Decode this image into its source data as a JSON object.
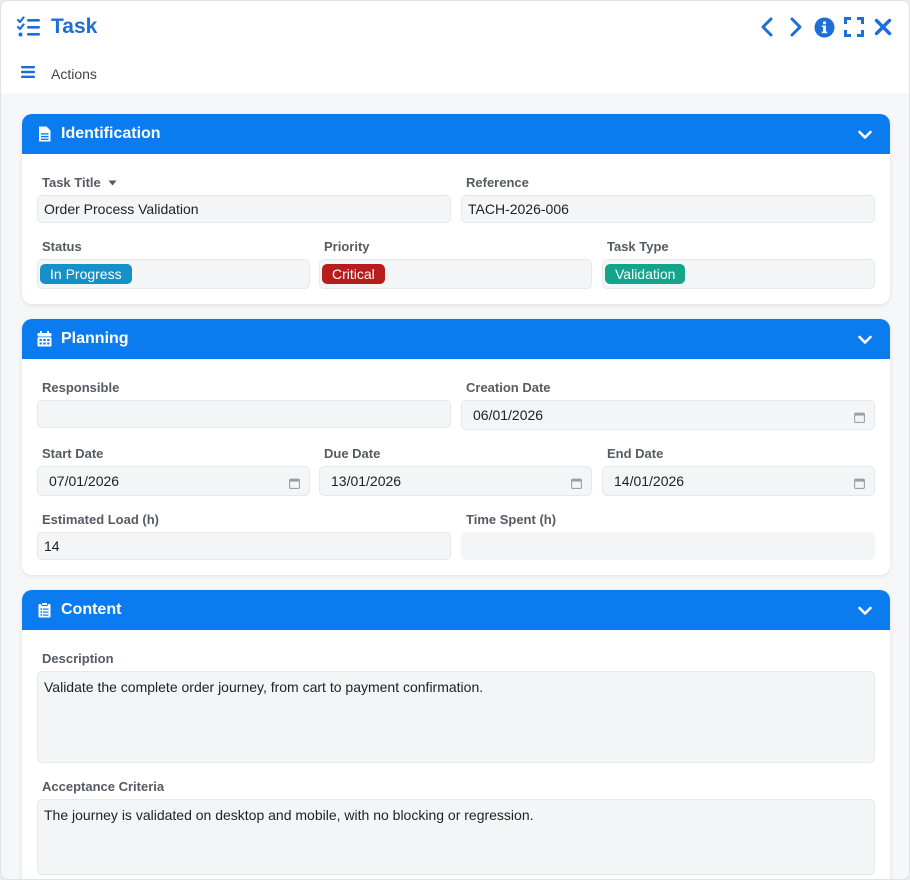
{
  "window": {
    "title": "Task",
    "actions_label": "Actions",
    "icons": [
      "tasks-list-icon",
      "chevron-left-icon",
      "chevron-right-icon",
      "info-icon",
      "fullscreen-icon",
      "close-icon",
      "hamburger-menu-icon"
    ]
  },
  "colors": {
    "accent": "#0b7bf0",
    "title": "#1d6fd8",
    "status_in_progress": "#1690c8",
    "priority_critical": "#b81d1d",
    "type_validation": "#12a58c"
  },
  "identification": {
    "section_title": "Identification",
    "task_title_label": "Task Title",
    "task_title_value": "Order Process Validation",
    "reference_label": "Reference",
    "reference_value": "TACH-2026-006",
    "status_label": "Status",
    "status_value": "In Progress",
    "priority_label": "Priority",
    "priority_value": "Critical",
    "task_type_label": "Task Type",
    "task_type_value": "Validation"
  },
  "planning": {
    "section_title": "Planning",
    "responsible_label": "Responsible",
    "responsible_value": "",
    "creation_date_label": "Creation Date",
    "creation_date_value": "06/01/2026",
    "start_date_label": "Start Date",
    "start_date_value": "07/01/2026",
    "due_date_label": "Due Date",
    "due_date_value": "13/01/2026",
    "end_date_label": "End Date",
    "end_date_value": "14/01/2026",
    "estimated_load_label": "Estimated Load (h)",
    "estimated_load_value": "14",
    "time_spent_label": "Time Spent (h)",
    "time_spent_value": ""
  },
  "content": {
    "section_title": "Content",
    "description_label": "Description",
    "description_value": "Validate the complete order journey, from cart to payment confirmation.",
    "acceptance_label": "Acceptance Criteria",
    "acceptance_value": "The journey is validated on desktop and mobile, with no blocking or regression."
  }
}
